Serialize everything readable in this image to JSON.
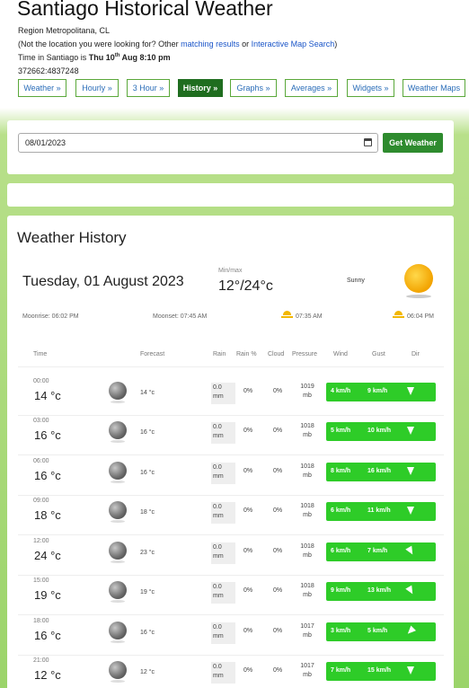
{
  "header": {
    "title": "Santiago Historical Weather",
    "region": "Region Metropolitana, CL",
    "not_location_prefix": "(Not the location you were looking for? Other ",
    "matching_link": "matching results",
    "or_text": " or ",
    "map_link": "Interactive Map Search",
    "not_location_suffix": ")",
    "time_prefix": "Time in Santiago is ",
    "time_day": "Thu 10",
    "time_sup": "th",
    "time_rest": " Aug 8:10 pm",
    "coords": "372662:4837248"
  },
  "nav": [
    {
      "label": "Weather »",
      "active": false
    },
    {
      "label": "Hourly »",
      "active": false
    },
    {
      "label": "3 Hour »",
      "active": false
    },
    {
      "label": "History »",
      "active": true
    },
    {
      "label": "Graphs »",
      "active": false
    },
    {
      "label": "Averages »",
      "active": false
    },
    {
      "label": "Widgets »",
      "active": false
    },
    {
      "label": "Weather Maps",
      "active": false
    }
  ],
  "date_form": {
    "value": "08/01/2023",
    "button": "Get Weather"
  },
  "history": {
    "title": "Weather History",
    "date": "Tuesday, 01 August 2023",
    "minmax_label": "Min/max",
    "minmax": "12°/24°c",
    "condition": "Sunny",
    "moonrise": "Moonrise: 06:02 PM",
    "moonset": "Moonset: 07:45 AM",
    "sunrise": "07:35 AM",
    "sunset": "06:04 PM"
  },
  "table": {
    "headers": {
      "time": "Time",
      "forecast": "Forecast",
      "rain": "Rain",
      "rain_pct": "Rain %",
      "cloud": "Cloud",
      "pressure": "Pressure",
      "wind": "Wind",
      "gust": "Gust",
      "dir": "Dir"
    },
    "rows": [
      {
        "time": "00:00",
        "temp": "14 °c",
        "forecast": "14 °c",
        "rain": "0.0",
        "rain_unit": "mm",
        "rain_pct": "0%",
        "cloud": "0%",
        "pressure": "1019",
        "pressure_unit": "mb",
        "wind": "4 km/h",
        "gust": "9 km/h",
        "dir_deg": 0
      },
      {
        "time": "03:00",
        "temp": "16 °c",
        "forecast": "16 °c",
        "rain": "0.0",
        "rain_unit": "mm",
        "rain_pct": "0%",
        "cloud": "0%",
        "pressure": "1018",
        "pressure_unit": "mb",
        "wind": "5 km/h",
        "gust": "10 km/h",
        "dir_deg": 0
      },
      {
        "time": "06:00",
        "temp": "16 °c",
        "forecast": "16 °c",
        "rain": "0.0",
        "rain_unit": "mm",
        "rain_pct": "0%",
        "cloud": "0%",
        "pressure": "1018",
        "pressure_unit": "mb",
        "wind": "8 km/h",
        "gust": "16 km/h",
        "dir_deg": 0
      },
      {
        "time": "09:00",
        "temp": "18 °c",
        "forecast": "18 °c",
        "rain": "0.0",
        "rain_unit": "mm",
        "rain_pct": "0%",
        "cloud": "0%",
        "pressure": "1018",
        "pressure_unit": "mb",
        "wind": "6 km/h",
        "gust": "11 km/h",
        "dir_deg": 0
      },
      {
        "time": "12:00",
        "temp": "24 °c",
        "forecast": "23 °c",
        "rain": "0.0",
        "rain_unit": "mm",
        "rain_pct": "0%",
        "cloud": "0%",
        "pressure": "1018",
        "pressure_unit": "mb",
        "wind": "6 km/h",
        "gust": "7 km/h",
        "dir_deg": -30
      },
      {
        "time": "15:00",
        "temp": "19 °c",
        "forecast": "19 °c",
        "rain": "0.0",
        "rain_unit": "mm",
        "rain_pct": "0%",
        "cloud": "0%",
        "pressure": "1018",
        "pressure_unit": "mb",
        "wind": "9 km/h",
        "gust": "13 km/h",
        "dir_deg": -30
      },
      {
        "time": "18:00",
        "temp": "16 °c",
        "forecast": "16 °c",
        "rain": "0.0",
        "rain_unit": "mm",
        "rain_pct": "0%",
        "cloud": "0%",
        "pressure": "1017",
        "pressure_unit": "mb",
        "wind": "3 km/h",
        "gust": "5 km/h",
        "dir_deg": 45
      },
      {
        "time": "21:00",
        "temp": "12 °c",
        "forecast": "12 °c",
        "rain": "0.0",
        "rain_unit": "mm",
        "rain_pct": "0%",
        "cloud": "0%",
        "pressure": "1017",
        "pressure_unit": "mb",
        "wind": "7 km/h",
        "gust": "15 km/h",
        "dir_deg": 0
      }
    ]
  },
  "colors": {
    "accent_green": "#2ecc28",
    "nav_active": "#1f6d1f",
    "link_blue": "#1a55c8"
  }
}
